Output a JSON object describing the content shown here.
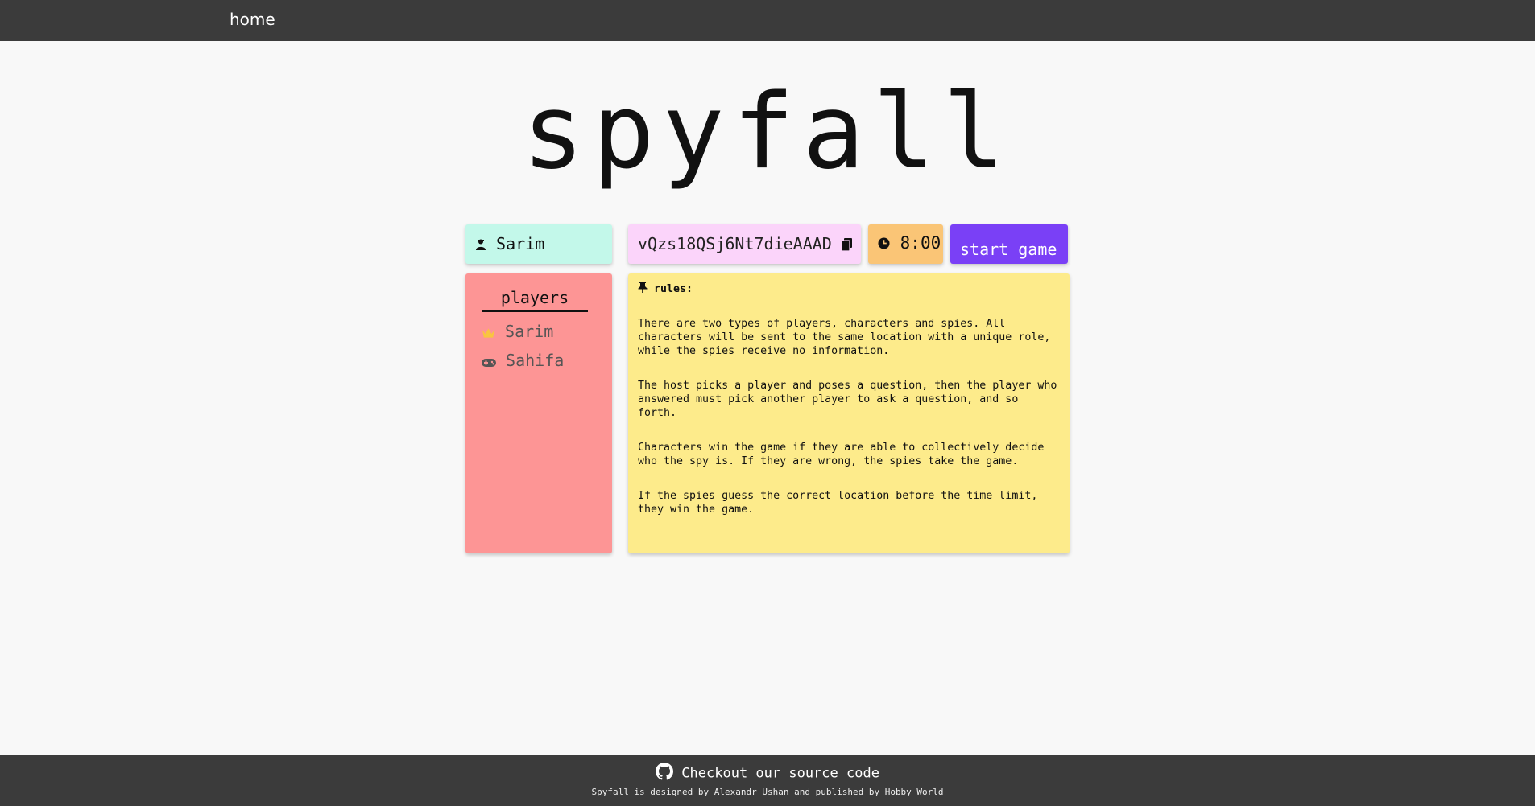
{
  "nav": {
    "home_label": "home"
  },
  "logo": "spyfall",
  "user": {
    "name": "Sarim",
    "icon": "user-icon"
  },
  "room": {
    "code": "vQzs18QSj6Nt7dieAAAD",
    "copy_icon": "copy-icon"
  },
  "timer": {
    "value": "8:00",
    "icon": "clock-icon"
  },
  "actions": {
    "start_label": "start game"
  },
  "players": {
    "title": "players",
    "list": [
      {
        "name": "Sarim",
        "icon": "crown-icon"
      },
      {
        "name": "Sahifa",
        "icon": "gamepad-icon"
      }
    ]
  },
  "rules": {
    "title": "rules:",
    "icon": "pin-icon",
    "paragraphs": [
      "There are two types of players, characters and spies. All characters will be sent to the same location with a unique role, while the spies receive no information.",
      "The host picks a player and poses a question, then the player who answered must pick another player to ask a question, and so forth.",
      "Characters win the game if they are able to collectively decide who the spy is. If they are wrong, the spies take the game.",
      "If the spies guess the correct location before the time limit, they win the game."
    ]
  },
  "footer": {
    "source_label": "Checkout our source code",
    "icon": "github-icon",
    "credit": "Spyfall is designed by Alexandr Ushan and published by Hobby World"
  },
  "colors": {
    "nav_bg": "#3b3b3b",
    "name_card": "#c3f8ea",
    "code_card": "#fbd4fa",
    "timer_card": "#fac576",
    "start_button": "#7a40f6",
    "players_card": "#fd9595",
    "rules_card": "#fdeb8b"
  }
}
